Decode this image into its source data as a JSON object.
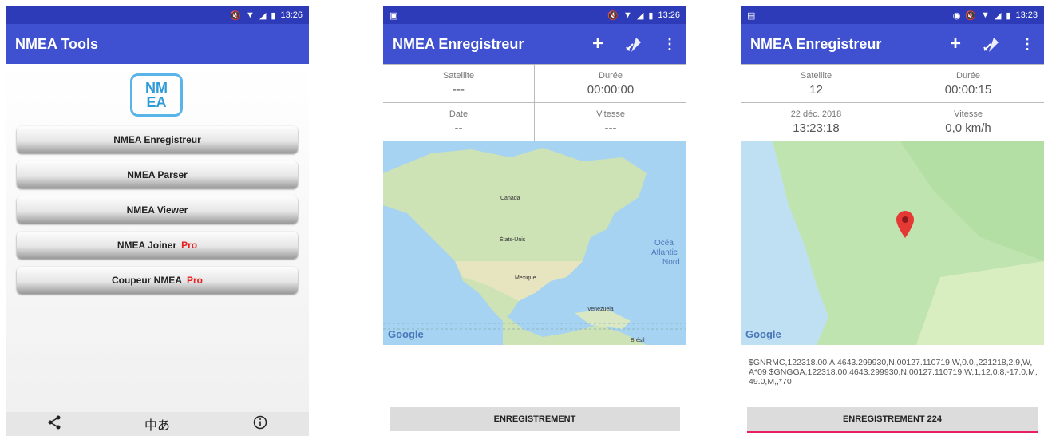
{
  "screen1": {
    "status_time": "13:26",
    "title": "NMEA Tools",
    "logo_line1": "NM",
    "logo_line2": "EA",
    "buttons": [
      {
        "label": "NMEA Enregistreur",
        "badge": ""
      },
      {
        "label": "NMEA Parser",
        "badge": ""
      },
      {
        "label": "NMEA Viewer",
        "badge": ""
      },
      {
        "label": "NMEA Joiner",
        "badge": "Pro"
      },
      {
        "label": "Coupeur NMEA",
        "badge": "Pro"
      }
    ],
    "nav_icons": [
      "share-icon",
      "translate-icon",
      "info-icon"
    ]
  },
  "screen2": {
    "status_time": "13:26",
    "title": "NMEA Enregistreur",
    "stats": [
      {
        "label": "Satellite",
        "value": "---"
      },
      {
        "label": "Durée",
        "value": "00:00:00"
      },
      {
        "label": "Date",
        "value": "--"
      },
      {
        "label": "Vitesse",
        "value": "---"
      }
    ],
    "map_labels": {
      "canada": "Canada",
      "usa": "États-Unis",
      "mexico": "Mexique",
      "venezuela": "Venezuela",
      "ocean_1": "Océa",
      "ocean_2": "Atlantic",
      "ocean_3": "Nord",
      "brazil": "Brésil"
    },
    "google": "Google",
    "record_label": "ENREGISTREMENT"
  },
  "screen3": {
    "status_time": "13:23",
    "title": "NMEA Enregistreur",
    "stats": [
      {
        "label": "Satellite",
        "value": "12"
      },
      {
        "label": "Durée",
        "value": "00:00:15"
      },
      {
        "label": "22 déc. 2018",
        "value": "13:23:18"
      },
      {
        "label": "Vitesse",
        "value": "0,0 km/h"
      }
    ],
    "google": "Google",
    "nmea_text": "$GNRMC,122318.00,A,4643.299930,N,00127.110719,W,0.0,,221218,2.9,W,A*09 $GNGGA,122318.00,4643.299930,N,00127.110719,W,1,12,0.8,-17.0,M,49.0,M,,*70",
    "record_label": "ENREGISTREMENT 224"
  },
  "colors": {
    "appbar": "#3f51d0",
    "statusbar": "#2d3bb8",
    "pro": "#e52020",
    "marker": "#e53935"
  }
}
